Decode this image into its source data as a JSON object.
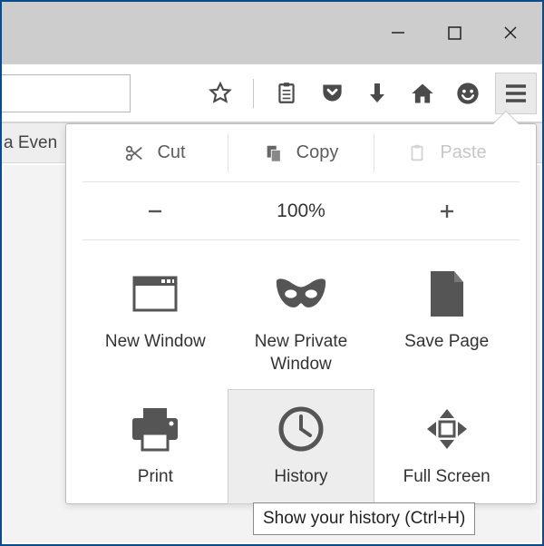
{
  "window": {
    "minimize": "Minimize",
    "maximize": "Maximize",
    "close": "Close"
  },
  "tab": {
    "title_fragment": "a Even"
  },
  "toolbar": {
    "star": "Bookmark",
    "clipboard": "Reader",
    "pocket": "Pocket",
    "download": "Downloads",
    "home": "Home",
    "smiley": "Feedback",
    "menu": "Menu"
  },
  "menu": {
    "cut": "Cut",
    "copy": "Copy",
    "paste": "Paste",
    "zoom_out": "−",
    "zoom_level": "100%",
    "zoom_in": "+",
    "items": [
      {
        "label": "New Window"
      },
      {
        "label": "New Private Window"
      },
      {
        "label": "Save Page"
      },
      {
        "label": "Print"
      },
      {
        "label": "History"
      },
      {
        "label": "Full Screen"
      }
    ]
  },
  "tooltip": "Show your history (Ctrl+H)"
}
